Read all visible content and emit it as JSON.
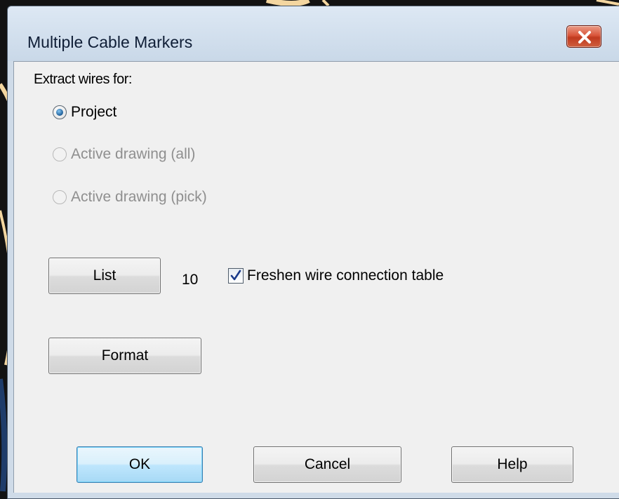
{
  "window": {
    "title": "Multiple Cable Markers",
    "close_icon": "close-icon"
  },
  "extract": {
    "label": "Extract wires for:",
    "options": [
      {
        "label": "Project",
        "checked": true,
        "enabled": true
      },
      {
        "label": "Active drawing (all)",
        "checked": false,
        "enabled": false
      },
      {
        "label": "Active drawing (pick)",
        "checked": false,
        "enabled": false
      }
    ]
  },
  "list": {
    "button_label": "List",
    "count": "10",
    "freshen_label": "Freshen wire connection table",
    "freshen_checked": true
  },
  "format": {
    "button_label": "Format"
  },
  "footer": {
    "ok_label": "OK",
    "cancel_label": "Cancel",
    "help_label": "Help"
  },
  "colors": {
    "accent": "#3c7fb1",
    "close_button": "#c9472b",
    "background_art": "#f5d9a8"
  }
}
